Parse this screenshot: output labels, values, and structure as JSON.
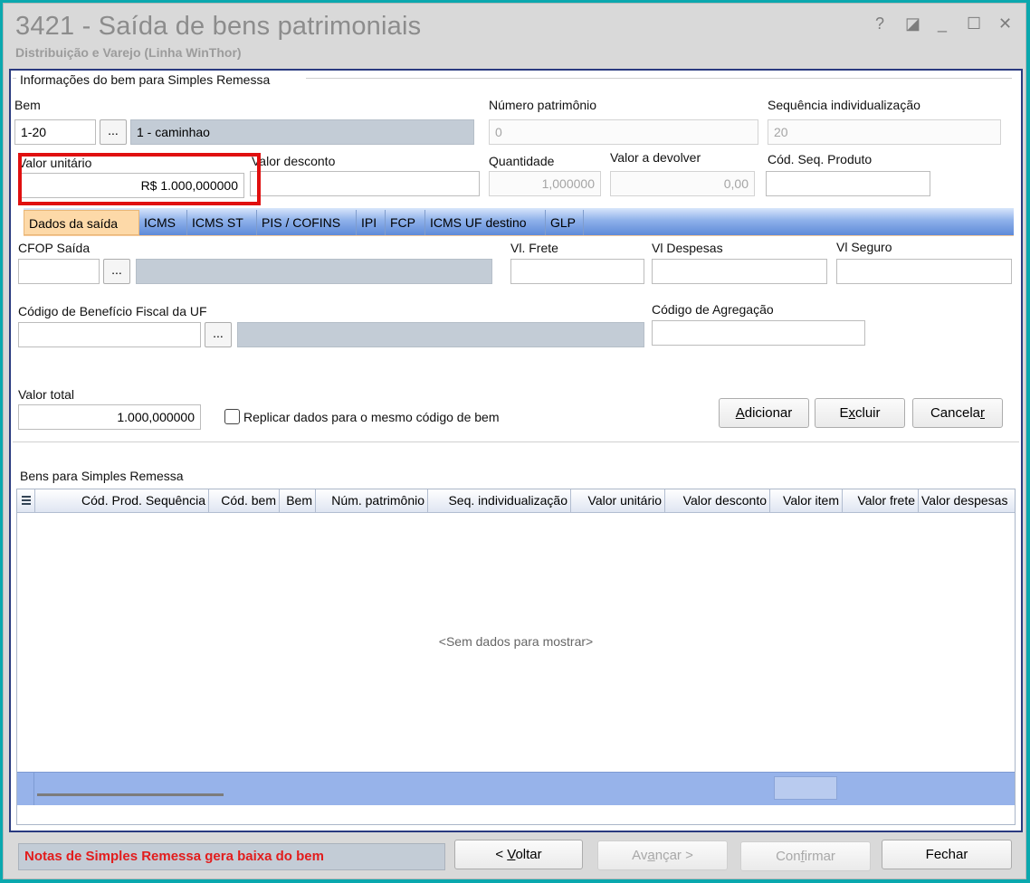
{
  "window": {
    "title": "3421 - Saída de bens patrimoniais",
    "subtitle": "Distribuição e Varejo (Linha WinThor)",
    "controls": {
      "help": "?",
      "restore": "◪",
      "minimize": "_",
      "maximize": "☐",
      "close": "✕"
    }
  },
  "info_group": {
    "title": "Informações do bem para Simples Remessa",
    "bem": {
      "label": "Bem",
      "code": "1-20",
      "dots": "...",
      "description": "1 - caminhao"
    },
    "numero_patrimonio": {
      "label": "Número patrimônio",
      "value": "0"
    },
    "sequencia": {
      "label": "Sequência individualização",
      "value": "20"
    },
    "valor_unitario": {
      "label": "Valor unitário",
      "value": "R$ 1.000,000000"
    },
    "valor_desconto": {
      "label": "Valor desconto",
      "value": ""
    },
    "quantidade": {
      "label": "Quantidade",
      "value": "1,000000"
    },
    "valor_devolver": {
      "label": "Valor a devolver",
      "value": "0,00"
    },
    "cod_seq_produto": {
      "label": "Cód. Seq. Produto",
      "value": ""
    }
  },
  "tabs": [
    "Dados da saída",
    "ICMS",
    "ICMS ST",
    "PIS / COFINS",
    "IPI",
    "FCP",
    "ICMS UF destino",
    "GLP"
  ],
  "dados_saida": {
    "cfop": {
      "label": "CFOP Saída",
      "dots": "..."
    },
    "vl_frete": {
      "label": "Vl. Frete"
    },
    "vl_despesas": {
      "label": "Vl Despesas"
    },
    "vl_seguro": {
      "label": "Vl Seguro"
    },
    "cod_beneficio": {
      "label": "Código de Benefício Fiscal da UF",
      "dots": "..."
    },
    "cod_agregacao": {
      "label": "Código de Agregação"
    },
    "valor_total": {
      "label": "Valor total",
      "value": "1.000,000000"
    },
    "replicar": {
      "label": "Replicar dados para o mesmo código de bem",
      "checked": false
    }
  },
  "actions": {
    "adicionar": {
      "pre": "",
      "ul": "A",
      "post": "dicionar"
    },
    "excluir": {
      "pre": "E",
      "ul": "x",
      "post": "cluir"
    },
    "cancelar": {
      "pre": "Cancela",
      "ul": "r",
      "post": ""
    }
  },
  "grid": {
    "title": "Bens para Simples Remessa",
    "columns": [
      "Cód. Prod. Sequência",
      "Cód. bem",
      "Bem",
      "Núm. patrimônio",
      "Seq. individualização",
      "Valor unitário",
      "Valor desconto",
      "Valor item",
      "Valor frete",
      "Valor despesas"
    ],
    "empty_text": "<Sem dados para mostrar>"
  },
  "footer": {
    "status": "Notas de Simples Remessa gera baixa do bem",
    "voltar": {
      "pre": "< ",
      "ul": "V",
      "post": "oltar"
    },
    "avancar": {
      "pre": "Av",
      "ul": "a",
      "post": "nçar >"
    },
    "confirmar": {
      "pre": "Con",
      "ul": "f",
      "post": "irmar"
    },
    "fechar": "Fechar"
  },
  "colors": {
    "highlight": "#e01010",
    "status_text": "#e21d1d",
    "tab_active": "#fdd9a8",
    "grid_footer": "#97b3ea"
  }
}
